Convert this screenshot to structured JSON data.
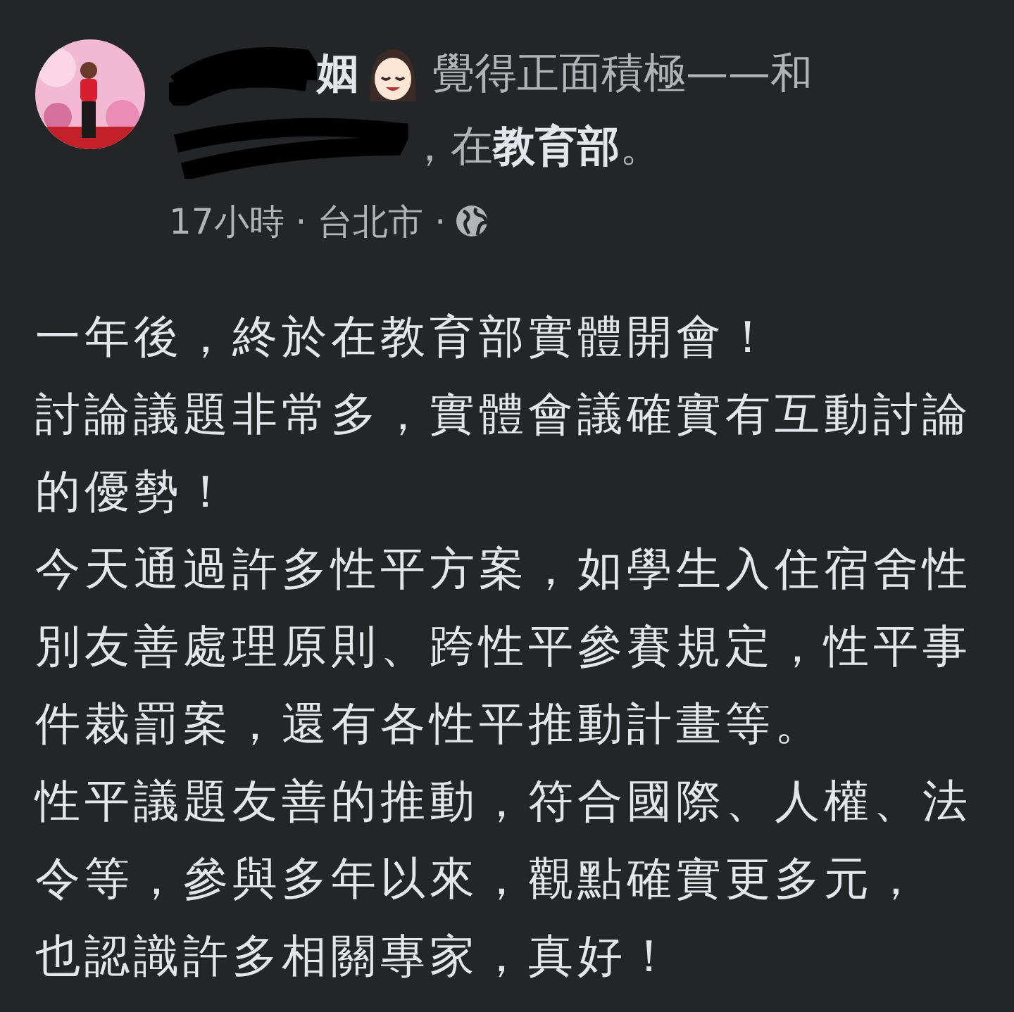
{
  "post": {
    "header": {
      "name_visible": "姻",
      "action": "覺得正面積極——和",
      "joiner": "，在",
      "place": "教育部",
      "end": "。"
    },
    "meta": "17小時 · 台北市 ·",
    "paragraphs": [
      "一年後，終於在教育部實體開會！",
      "討論議題非常多，實體會議確實有互動討論的優勢！",
      "今天通過許多性平方案，如學生入住宿舍性別友善處理原則、跨性平參賽規定，性平事件裁罰案，還有各性平推動計畫等。",
      "性平議題友善的推動，符合國際、人權、法令等，參與多年以來，觀點確實更多元，",
      "也認識許多相關專家，真好！"
    ]
  }
}
